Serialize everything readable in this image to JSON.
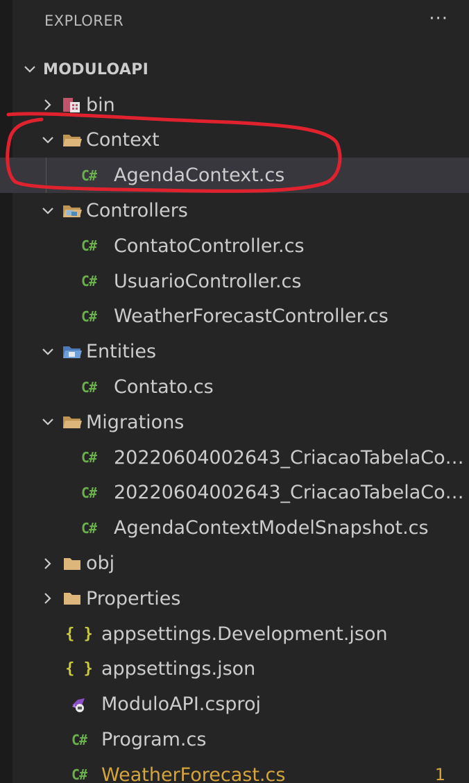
{
  "explorer": {
    "title": "EXPLORER",
    "more_label": "···"
  },
  "tree": {
    "root": "MODULOAPI",
    "bin": "bin",
    "context": {
      "label": "Context",
      "files": [
        "AgendaContext.cs"
      ]
    },
    "controllers": {
      "label": "Controllers",
      "files": [
        "ContatoController.cs",
        "UsuarioController.cs",
        "WeatherForecastController.cs"
      ]
    },
    "entities": {
      "label": "Entities",
      "files": [
        "Contato.cs"
      ]
    },
    "migrations": {
      "label": "Migrations",
      "files": [
        "20220604002643_CriacaoTabelaCont...",
        "20220604002643_CriacaoTabelaCont...",
        "AgendaContextModelSnapshot.cs"
      ]
    },
    "obj": "obj",
    "properties": "Properties",
    "root_files": {
      "appsettings_dev": "appsettings.Development.json",
      "appsettings": "appsettings.json",
      "csproj": "ModuloAPI.csproj",
      "program": "Program.cs",
      "weather": "WeatherForecast.cs",
      "weather_badge": "1"
    },
    "icons": {
      "cs": "C#",
      "json": "{ }"
    }
  },
  "colors": {
    "background": "#252526",
    "selected": "#37373d",
    "csharp": "#6ab04c",
    "json": "#cbcb41",
    "warning": "#d5a53c",
    "annotation": "#e0222f"
  }
}
